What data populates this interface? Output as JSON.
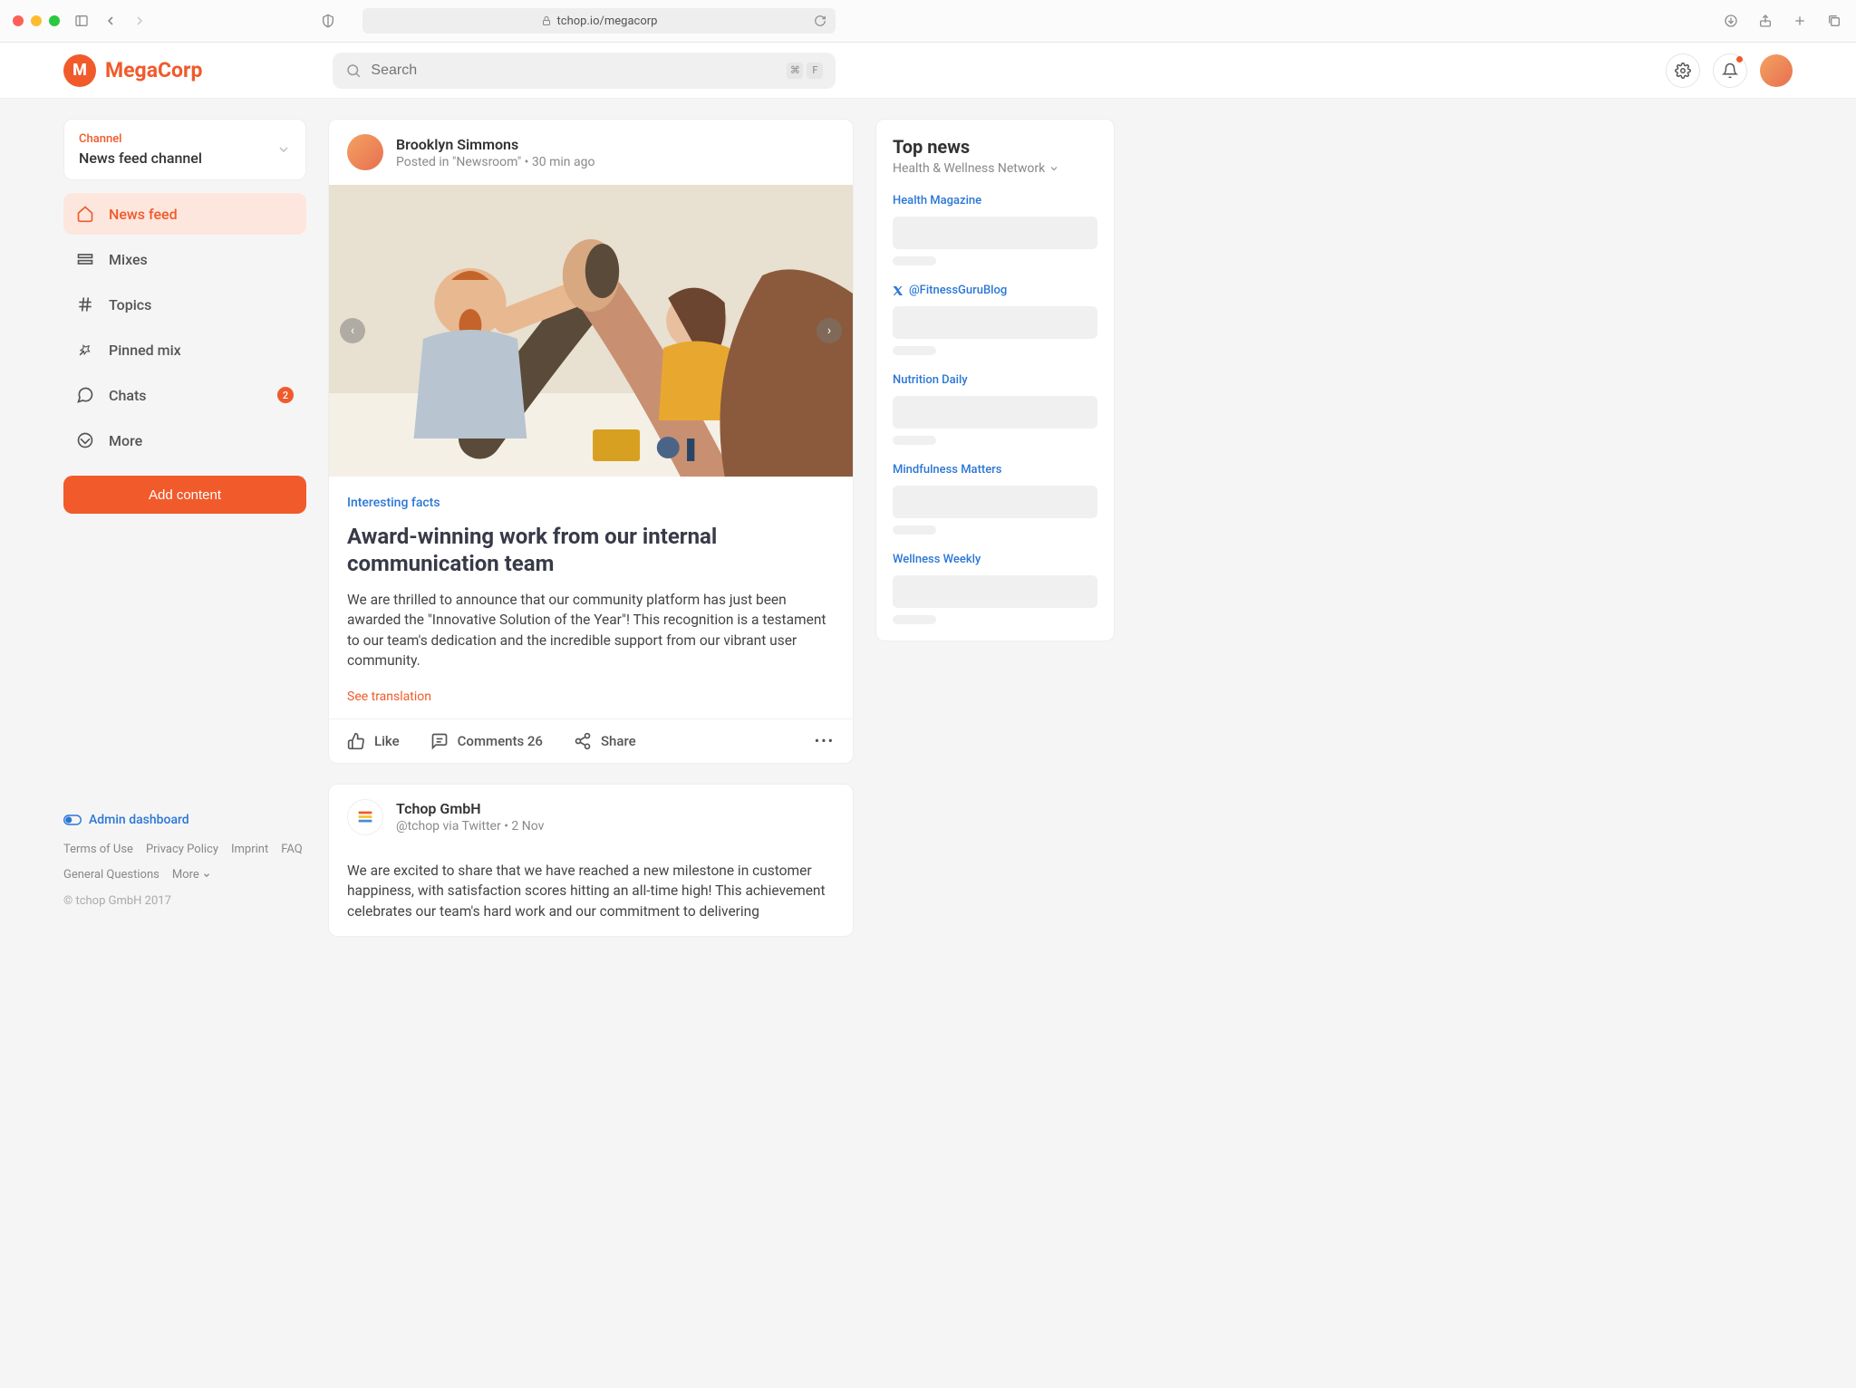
{
  "browser": {
    "url": "tchop.io/megacorp"
  },
  "app": {
    "brand_name": "MegaCorp",
    "brand_letter": "M",
    "search_placeholder": "Search",
    "shortcut_cmd": "⌘",
    "shortcut_key": "F"
  },
  "sidebar": {
    "channel_label": "Channel",
    "channel_name": "News feed channel",
    "nav": [
      {
        "label": "News feed",
        "active": true
      },
      {
        "label": "Mixes"
      },
      {
        "label": "Topics"
      },
      {
        "label": "Pinned mix"
      },
      {
        "label": "Chats",
        "badge": "2"
      },
      {
        "label": "More"
      }
    ],
    "add_content": "Add content",
    "admin_link": "Admin dashboard",
    "legal": [
      "Terms of Use",
      "Privacy Policy",
      "Imprint",
      "FAQ",
      "General Questions",
      "More"
    ],
    "copyright": "© tchop GmbH 2017"
  },
  "feed": {
    "posts": [
      {
        "author": "Brooklyn Simmons",
        "meta": "Posted in \"Newsroom\" • 30 min ago",
        "tag": "Interesting facts",
        "title": "Award-winning work from our internal communication team",
        "body": "We are thrilled to announce that our community platform has just been awarded the \"Innovative Solution of the Year\"! This recognition is a testament to our team's dedication and the incredible support from our vibrant user community.",
        "translate": "See translation",
        "actions": {
          "like": "Like",
          "comments": "Comments 26",
          "share": "Share"
        }
      },
      {
        "author": "Tchop GmbH",
        "meta": "@tchop via Twitter • 2 Nov",
        "body": "We are excited to share that we have reached a new milestone in customer happiness, with satisfaction scores hitting an all-time high! This achievement celebrates our team's hard work and our commitment to delivering"
      }
    ]
  },
  "right": {
    "title": "Top news",
    "subtitle": "Health & Wellness Network",
    "sources": [
      {
        "label": "Health Magazine"
      },
      {
        "label": "@FitnessGuruBlog",
        "twitter": true
      },
      {
        "label": "Nutrition Daily"
      },
      {
        "label": "Mindfulness Matters"
      },
      {
        "label": "Wellness Weekly"
      }
    ]
  }
}
